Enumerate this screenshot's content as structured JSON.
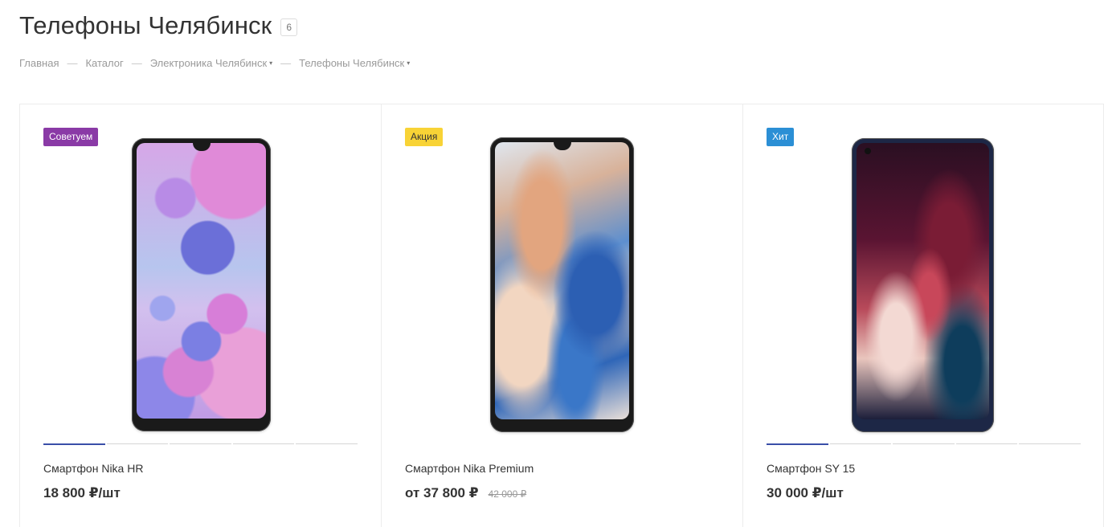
{
  "header": {
    "title": "Телефоны Челябинск",
    "count": "6"
  },
  "breadcrumb": [
    {
      "label": "Главная",
      "dropdown": false
    },
    {
      "label": "Каталог",
      "dropdown": false
    },
    {
      "label": "Электроника Челябинск",
      "dropdown": true
    },
    {
      "label": "Телефоны Челябинск",
      "dropdown": true
    }
  ],
  "breadcrumb_separator": "—",
  "caret_glyph": "▾",
  "products": [
    {
      "tag": "Советуем",
      "tag_color": "#8a3aa6",
      "name": "Смартфон Nika HR",
      "price": "18 800 ₽/шт",
      "old_price": "",
      "gallery_total": 5,
      "gallery_active": 1
    },
    {
      "tag": "Акция",
      "tag_color": "#f8d336",
      "name": "Смартфон Nika Premium",
      "price": "от 37 800 ₽",
      "old_price": "42 000 ₽",
      "gallery_total": 0,
      "gallery_active": 0
    },
    {
      "tag": "Хит",
      "tag_color": "#2b8fd5",
      "name": "Смартфон SY 15",
      "price": "30 000 ₽/шт",
      "old_price": "",
      "gallery_total": 5,
      "gallery_active": 1
    }
  ],
  "colors": {
    "slider_active": "#3a4ea8",
    "border": "#ececec"
  }
}
